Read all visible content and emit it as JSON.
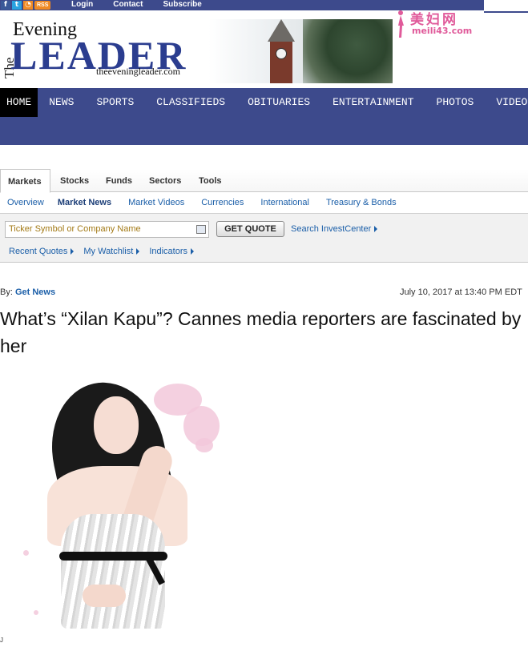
{
  "topbar": {
    "social": {
      "facebook": "f",
      "twitter": "t",
      "rss": "RSS"
    },
    "links": [
      "Login",
      "Contact",
      "Subscribe"
    ]
  },
  "masthead": {
    "the": "The",
    "evening": "Evening",
    "leader": "LEADER",
    "url": "theeveningleader.com"
  },
  "watermark": {
    "chinese": "美妇网",
    "url": "meili43.com"
  },
  "main_nav": [
    "HOME",
    "NEWS",
    "SPORTS",
    "CLASSIFIEDS",
    "OBITUARIES",
    "ENTERTAINMENT",
    "PHOTOS",
    "VIDEOS"
  ],
  "markets": {
    "tabs": [
      "Markets",
      "Stocks",
      "Funds",
      "Sectors",
      "Tools"
    ],
    "subtabs": [
      "Overview",
      "Market News",
      "Market Videos",
      "Currencies",
      "International",
      "Treasury & Bonds"
    ],
    "ticker_placeholder": "Ticker Symbol or Company Name",
    "get_quote": "GET QUOTE",
    "invest_center": "Search InvestCenter",
    "quick_links": [
      "Recent Quotes",
      "My Watchlist",
      "Indicators"
    ]
  },
  "article": {
    "by_label": "By:",
    "author": "Get News",
    "date": "July 10, 2017 at 13:40 PM EDT",
    "headline": "What’s “Xilan Kapu”? Cannes media reporters are fascinated by her"
  },
  "footer_mark": "J"
}
